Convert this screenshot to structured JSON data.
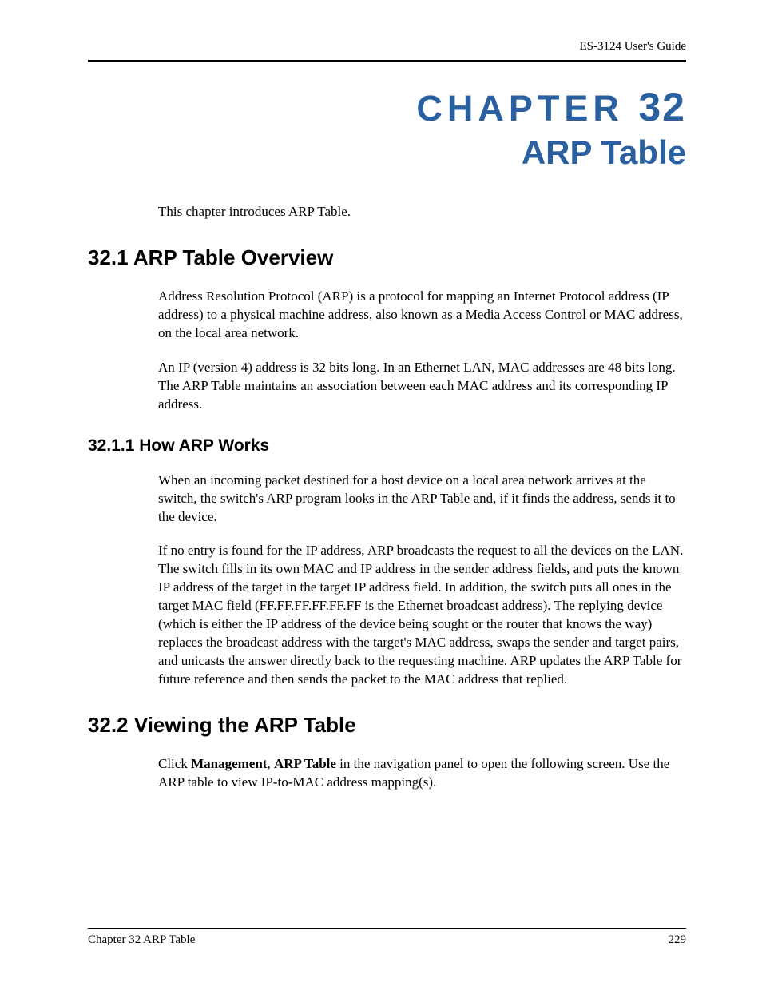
{
  "header": {
    "guide_title": "ES-3124 User's Guide"
  },
  "chapter": {
    "label_prefix": "CHAPTER",
    "label_number": "32",
    "subtitle": "ARP Table",
    "intro": "This chapter introduces ARP Table."
  },
  "sections": {
    "s1": {
      "title": "32.1  ARP Table Overview",
      "p1": "Address Resolution Protocol (ARP) is a protocol for mapping an Internet Protocol address (IP address) to a physical machine address, also known as a Media Access Control or MAC address, on the local area network.",
      "p2": "An IP (version 4) address is 32 bits long. In an Ethernet LAN, MAC addresses are 48 bits long. The ARP Table maintains an association between each MAC address and its corresponding IP address."
    },
    "s1_1": {
      "title": "32.1.1  How ARP Works",
      "p1": "When an incoming packet destined for a host device on a local area network arrives at the switch, the switch's ARP program looks in the ARP Table and, if it finds the address, sends it to the device.",
      "p2": "If no entry is found for the IP address, ARP broadcasts the request to all the devices on the LAN. The switch fills in its own MAC and IP address in the sender address fields, and puts the known IP address of the target in the target IP address field. In addition, the switch puts all ones in the target MAC field (FF.FF.FF.FF.FF.FF is the Ethernet broadcast address). The replying device (which is either the IP address of the device being sought or the router that knows the way) replaces the broadcast address with the target's MAC address, swaps the sender and target pairs, and unicasts the answer directly back to the requesting machine. ARP updates the ARP Table for future reference and then sends the packet to the MAC address that replied."
    },
    "s2": {
      "title": "32.2  Viewing the ARP Table",
      "p1_pre": "Click ",
      "p1_bold1": "Management",
      "p1_mid": ", ",
      "p1_bold2": "ARP Table",
      "p1_post": " in the navigation panel to open the following screen. Use the ARP table to view IP-to-MAC address mapping(s)."
    }
  },
  "footer": {
    "left": "Chapter 32 ARP Table",
    "right": "229"
  }
}
